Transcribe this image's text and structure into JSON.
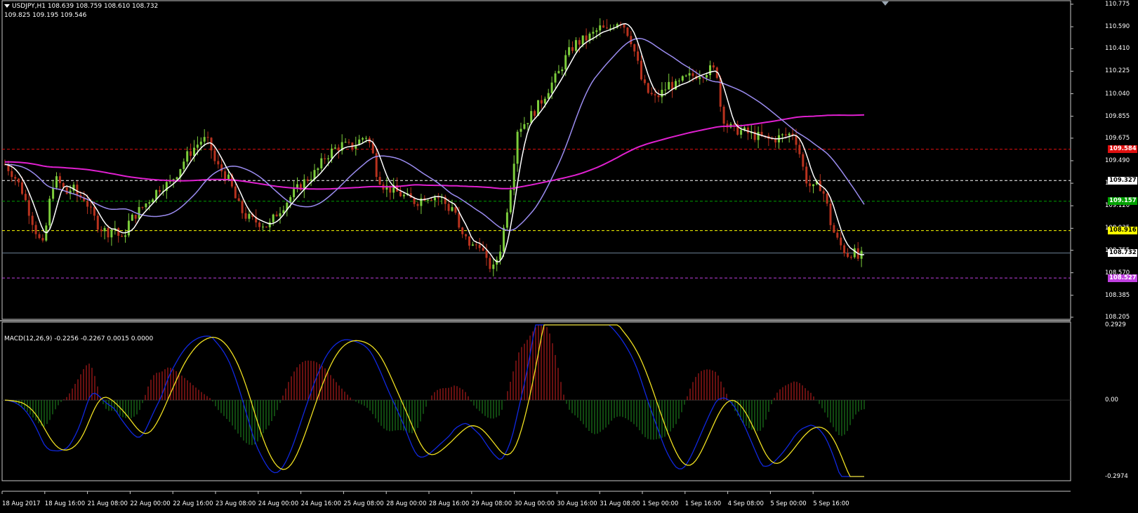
{
  "symbol_header": "USDJPY,H1  108.639 108.759 108.610 108.732",
  "ma_header": "109.825 109.195 109.546",
  "macd_header": "MACD(12,26,9) -0.2256 -0.2267 0.0015 0.0000",
  "price_axis": {
    "ticks": [
      "110.775",
      "110.590",
      "110.410",
      "110.225",
      "110.040",
      "109.855",
      "109.675",
      "109.490",
      "109.305",
      "109.120",
      "108.935",
      "108.755",
      "108.570",
      "108.385",
      "108.205"
    ],
    "ymin": 108.205,
    "ymax": 110.775
  },
  "macd_axis": {
    "ticks": [
      "0.2929",
      "0.00",
      "-0.2974"
    ],
    "ymin": -0.2974,
    "ymax": 0.2929
  },
  "price_levels": [
    {
      "value": 109.584,
      "label": "109.584",
      "color": "#e01010",
      "text_color": "#ffffff"
    },
    {
      "value": 109.327,
      "label": "109.327",
      "color": "#ffffff",
      "text_color": "#000000"
    },
    {
      "value": 109.157,
      "label": "109.157",
      "color": "#00a000",
      "text_color": "#ffffff"
    },
    {
      "value": 108.916,
      "label": "108.916",
      "color": "#ffff00",
      "text_color": "#000000"
    },
    {
      "value": 108.732,
      "label": "108.732",
      "color": "#ffffff",
      "text_color": "#000000"
    },
    {
      "value": 108.527,
      "label": "108.527",
      "color": "#c040e0",
      "text_color": "#ffffff"
    }
  ],
  "time_axis": [
    "18 Aug 2017",
    "18 Aug 16:00",
    "21 Aug 08:00",
    "22 Aug 00:00",
    "22 Aug 16:00",
    "23 Aug 08:00",
    "24 Aug 00:00",
    "24 Aug 16:00",
    "25 Aug 08:00",
    "28 Aug 00:00",
    "28 Aug 16:00",
    "29 Aug 08:00",
    "30 Aug 00:00",
    "30 Aug 16:00",
    "31 Aug 08:00",
    "1 Sep 00:00",
    "1 Sep 16:00",
    "4 Sep 08:00",
    "5 Sep 00:00",
    "5 Sep 16:00"
  ],
  "colors": {
    "bull": "#ffff00",
    "bear": "#e01010",
    "candle_bull": "#7ccd3b",
    "candle_bear": "#b8321e",
    "ma_fast": "#ffffff",
    "ma_mid": "#9b8cf0",
    "ma_slow": "#e020d0",
    "macd_line": "#1028e0",
    "signal_line": "#f0e020",
    "hist_pos": "#d02020",
    "hist_neg": "#209020"
  },
  "chart_data": [
    {
      "type": "candlestick",
      "title": "USDJPY,H1",
      "ylim": [
        108.205,
        110.775
      ],
      "close_path": [
        [
          0,
          109.46
        ],
        [
          12,
          109.38
        ],
        [
          24,
          109.25
        ],
        [
          36,
          109.05
        ],
        [
          48,
          108.85
        ],
        [
          55,
          108.78
        ],
        [
          62,
          109.1
        ],
        [
          70,
          109.35
        ],
        [
          78,
          109.3
        ],
        [
          88,
          109.22
        ],
        [
          96,
          109.27
        ],
        [
          104,
          109.2
        ],
        [
          114,
          109.18
        ],
        [
          124,
          109.05
        ],
        [
          134,
          108.95
        ],
        [
          146,
          108.9
        ],
        [
          156,
          108.95
        ],
        [
          166,
          108.82
        ],
        [
          176,
          108.98
        ],
        [
          186,
          109.05
        ],
        [
          198,
          109.12
        ],
        [
          210,
          109.2
        ],
        [
          222,
          109.28
        ],
        [
          234,
          109.3
        ],
        [
          246,
          109.4
        ],
        [
          258,
          109.52
        ],
        [
          270,
          109.6
        ],
        [
          282,
          109.67
        ],
        [
          292,
          109.62
        ],
        [
          300,
          109.46
        ],
        [
          310,
          109.4
        ],
        [
          320,
          109.32
        ],
        [
          330,
          109.15
        ],
        [
          340,
          109.05
        ],
        [
          352,
          109.0
        ],
        [
          364,
          108.98
        ],
        [
          376,
          108.95
        ],
        [
          386,
          109.05
        ],
        [
          396,
          109.12
        ],
        [
          408,
          109.2
        ],
        [
          420,
          109.28
        ],
        [
          432,
          109.35
        ],
        [
          444,
          109.4
        ],
        [
          456,
          109.52
        ],
        [
          468,
          109.58
        ],
        [
          480,
          109.62
        ],
        [
          492,
          109.6
        ],
        [
          504,
          109.65
        ],
        [
          514,
          109.7
        ],
        [
          522,
          109.6
        ],
        [
          530,
          109.38
        ],
        [
          540,
          109.28
        ],
        [
          552,
          109.25
        ],
        [
          562,
          109.22
        ],
        [
          574,
          109.18
        ],
        [
          586,
          109.15
        ],
        [
          598,
          109.2
        ],
        [
          610,
          109.2
        ],
        [
          622,
          109.18
        ],
        [
          632,
          109.1
        ],
        [
          640,
          109.12
        ],
        [
          648,
          108.88
        ],
        [
          656,
          108.85
        ],
        [
          666,
          108.78
        ],
        [
          676,
          108.82
        ],
        [
          686,
          108.65
        ],
        [
          696,
          108.6
        ],
        [
          706,
          108.78
        ],
        [
          714,
          109.05
        ],
        [
          722,
          109.35
        ],
        [
          730,
          109.75
        ],
        [
          740,
          109.8
        ],
        [
          752,
          109.88
        ],
        [
          764,
          109.98
        ],
        [
          776,
          110.1
        ],
        [
          788,
          110.2
        ],
        [
          800,
          110.35
        ],
        [
          812,
          110.45
        ],
        [
          824,
          110.48
        ],
        [
          836,
          110.52
        ],
        [
          848,
          110.58
        ],
        [
          858,
          110.55
        ],
        [
          868,
          110.62
        ],
        [
          876,
          110.65
        ],
        [
          884,
          110.58
        ],
        [
          892,
          110.48
        ],
        [
          900,
          110.32
        ],
        [
          908,
          110.12
        ],
        [
          916,
          110.05
        ],
        [
          926,
          110.0
        ],
        [
          936,
          110.05
        ],
        [
          946,
          110.12
        ],
        [
          956,
          110.1
        ],
        [
          966,
          110.15
        ],
        [
          976,
          110.18
        ],
        [
          986,
          110.2
        ],
        [
          996,
          110.22
        ],
        [
          1006,
          110.24
        ],
        [
          1014,
          110.22
        ],
        [
          1020,
          109.9
        ],
        [
          1028,
          109.78
        ],
        [
          1036,
          109.75
        ],
        [
          1046,
          109.74
        ],
        [
          1056,
          109.72
        ],
        [
          1066,
          109.7
        ],
        [
          1078,
          109.68
        ],
        [
          1090,
          109.66
        ],
        [
          1102,
          109.68
        ],
        [
          1114,
          109.7
        ],
        [
          1124,
          109.72
        ],
        [
          1132,
          109.55
        ],
        [
          1140,
          109.35
        ],
        [
          1150,
          109.25
        ],
        [
          1160,
          109.3
        ],
        [
          1168,
          109.2
        ],
        [
          1176,
          108.98
        ],
        [
          1184,
          108.85
        ],
        [
          1192,
          108.78
        ],
        [
          1200,
          108.72
        ],
        [
          1208,
          108.75
        ],
        [
          1216,
          108.68
        ],
        [
          1224,
          108.73
        ]
      ]
    },
    {
      "type": "line",
      "title": "MACD(12,26,9)",
      "ylim": [
        -0.2974,
        0.2929
      ]
    }
  ]
}
